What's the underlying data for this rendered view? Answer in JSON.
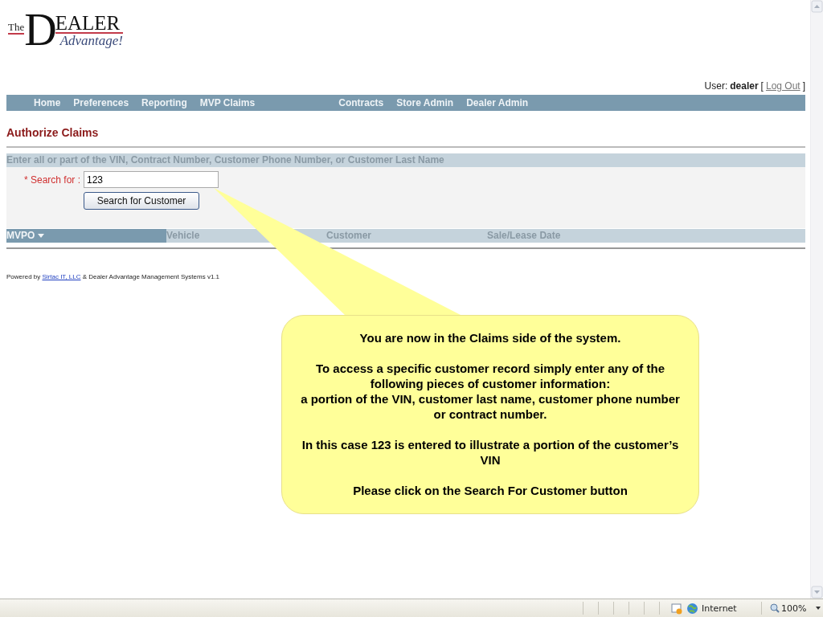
{
  "logo": {
    "prefix": "The",
    "initial": "D",
    "word": "EALER",
    "tagline": "Advantage!"
  },
  "user": {
    "label": "User:",
    "name": "dealer",
    "open_bracket": "[",
    "logout": "Log Out",
    "close_bracket": "]"
  },
  "nav": {
    "left": [
      "Home",
      "Preferences",
      "Reporting",
      "MVP Claims"
    ],
    "right": [
      "Contracts",
      "Store Admin",
      "Dealer Admin"
    ]
  },
  "page_title": "Authorize Claims",
  "search": {
    "hint": "Enter all or part of the VIN, Contract Number, Customer Phone Number, or Customer Last Name",
    "label": "* Search for :",
    "value": "123",
    "button": "Search for Customer"
  },
  "results": {
    "columns": [
      {
        "label": "MVPO",
        "sorted": true
      },
      {
        "label": "Vehicle",
        "sorted": false
      },
      {
        "label": "Customer",
        "sorted": false
      },
      {
        "label": "Sale/Lease Date",
        "sorted": false
      }
    ]
  },
  "footer": {
    "prefix": "Powered by",
    "link": "Sirtac IT, LLC",
    "suffix": "& Dealer Advantage Management Systems v1.1"
  },
  "callout": {
    "paragraphs": [
      [
        "You are now in the Claims side of the system."
      ],
      [
        "To access a specific customer record simply enter any of the following pieces of customer information:",
        "a portion of the VIN, customer last name, customer phone number or contract number."
      ],
      [
        "In this case 123 is entered to illustrate a portion of the customer’s VIN"
      ],
      [
        "Please click on the Search For Customer button"
      ]
    ]
  },
  "status_bar": {
    "zone": "Internet",
    "zoom": "100%"
  }
}
